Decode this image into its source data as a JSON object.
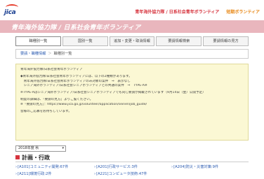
{
  "header": {
    "logo_text": "jica",
    "link_jocv": "青年海外協力隊 / 日系社会青年ボランティア",
    "link_short": "短期ボランティア"
  },
  "banner": {
    "title": "青年海外協力隊 / 日系社会青年ボランティア"
  },
  "nav": {
    "items": [
      "職種別一覧",
      "国別一覧",
      "追加・変更・取消情報",
      "要請情報検索",
      "要請情報の見方"
    ],
    "active_index": 0
  },
  "breadcrumb": {
    "home": "要請・職種情報",
    "current": "職種別一覧"
  },
  "notice": {
    "lines": [
      "青年海外協力隊/日系社会青年ボランティア",
      "",
      "◆青年海外協力隊/日系社会青年ボランティアには、以下の2種類があります。",
      "　青年海外協力隊/日系社会青年ボランティアのみ対象の案件　⇒　表示なし",
      "　シニア海外ボランティア/日系社会シニアボランティアとの共通の案件　⇒　TYPE-A※",
      "",
      "※TYPE-Aはシニア海外ボランティア/日系社会シニアボランティアでも同じ要請が掲載されています（9月14日（金）公開予定）",
      "",
      "制度の詳細は、「要請の見方」よりご覧ください。",
      "※「要請の見方」：https://www.jica.go.jp/volunteer/application/seinen/job_guide/",
      "",
      "皆様のご応募をお待ちしています。"
    ]
  },
  "fiscal_select": {
    "value": "2018年度 秋"
  },
  "section": {
    "title": "計画・行政"
  },
  "categories": [
    {
      "label": "[A101]コミュニティ開発:67件"
    },
    {
      "label": "[A201]行政サービス:3件"
    },
    {
      "label": "[A204]防災・災害対策:9件"
    },
    {
      "label": "[A211]環境行政:2件"
    },
    {
      "label": "[A221]コンピュータ技術:47件"
    }
  ]
}
